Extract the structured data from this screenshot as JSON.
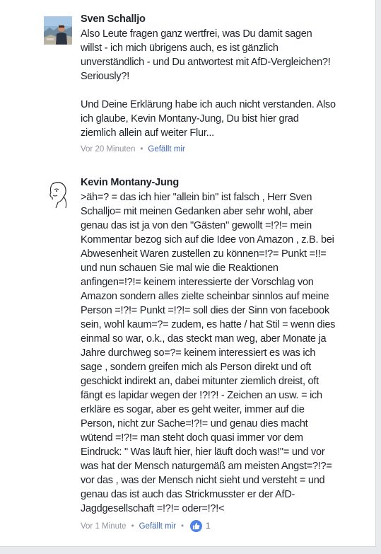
{
  "colors": {
    "background": "#e9eaed",
    "card": "#ffffff",
    "text": "#1d2129",
    "meta": "#90949c",
    "link": "#4267b2",
    "like_badge": "#4f81e8"
  },
  "comments": [
    {
      "author": "Sven Schalljo",
      "avatar_icon": "profile-photo",
      "lines": [
        "Also Leute fragen ganz wertfrei, was Du damit sagen",
        "willst - ich mich übrigens auch, es ist gänzlich",
        "unverständlich - und Du antwortest mit AfD-Vergleichen?!",
        "Seriously?!",
        "",
        "Und Deine Erklärung habe ich auch nicht verstanden. Also",
        "ich glaube, Kevin Montany-Jung, Du bist hier grad",
        "ziemlich allein auf weiter Flur..."
      ],
      "time": "Vor 20 Minuten",
      "separator": "•",
      "like_label": "Gefällt mir"
    },
    {
      "author": "Kevin Montany-Jung",
      "avatar_icon": "sketch-face-avatar",
      "lines": [
        ">äh=? = das ich hier \"allein bin\" ist falsch , Herr Sven",
        "Schalljo= mit meinen Gedanken aber sehr wohl, aber",
        "genau das ist ja von den \"Gästen\" gewollt =!?!=  mein",
        "Kommentar bezog sich auf die Idee von Amazon , z.B. bei",
        "Abwesenheit Waren zustellen zu können=!?= Punkt =!!=",
        "und nun schauen Sie mal wie die Reaktionen",
        "anfingen=!?!=  keinem interessierte der Vorschlag von",
        "Amazon sondern alles zielte scheinbar sinnlos auf meine",
        "Person =!?!= Punkt =!?!= soll dies der Sinn von facebook",
        "sein, wohl kaum=?= zudem, es hatte / hat Stil = wenn dies",
        "einmal so war,  o.k., das steckt man weg, aber Monate ja",
        "Jahre  durchweg so=?= keinem interessiert es was ich",
        "sage , sondern greifen mich als  Person direkt und oft",
        "geschickt indirekt an, dabei mitunter ziemlich dreist, oft",
        "fängt es lapidar wegen der !?!?! - Zeichen an usw. = ich",
        "erkläre es sogar, aber es geht weiter, immer auf die",
        "Person, nicht zur Sache=!?!=  und genau dies macht",
        "wütend =!?!= man steht doch quasi immer vor dem",
        "Eindruck: \" Was läuft hier, hier läuft doch was!\"= und vor",
        "was hat der Mensch naturgemäß am meisten Angst=?!?=",
        "vor das , was der Mensch nicht sieht und versteht = und",
        "genau das ist auch das Strickmusster er der AfD-",
        "Jagdgesellschaft  =!?!= oder=!?!<"
      ],
      "time": "Vor 1 Minute",
      "separator": "•",
      "like_label": "Gefällt mir",
      "reaction_icon": "thumbs-up-icon",
      "reaction_count": "1"
    }
  ]
}
